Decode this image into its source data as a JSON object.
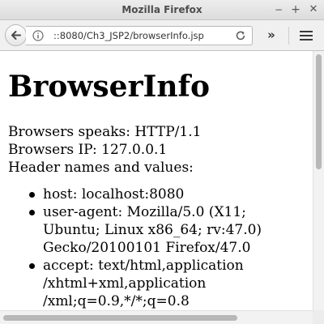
{
  "window": {
    "title": "Mozilla Firefox",
    "controls": {
      "minimize": "−",
      "maximize": "+",
      "close": "✕"
    }
  },
  "toolbar": {
    "back_icon": "back-arrow-icon",
    "info_icon": "info-icon",
    "url": "::8080/Ch3_JSP2/browserInfo.jsp",
    "reload_icon": "reload-icon",
    "overflow_label": "»",
    "menu_icon": "hamburger-menu-icon"
  },
  "page": {
    "heading": "BrowserInfo",
    "lines": [
      "Browsers speaks: HTTP/1.1",
      "Browsers IP: 127.0.0.1",
      "Header names and values:"
    ],
    "headers": [
      "host: localhost:8080",
      "user-agent: Mozilla/5.0 (X11;\nUbuntu; Linux x86_64; rv:47.0)\nGecko/20100101 Firefox/47.0",
      "accept: text/html,application\n/xhtml+xml,application\n/xml;q=0.9,*/*;q=0.8"
    ]
  },
  "scroll": {
    "vertical_fraction": 0.45,
    "horizontal_fraction": 0.75
  },
  "colors": {
    "titlebar": "#e3e3e3",
    "toolbar": "#f0f0f0",
    "content_bg": "#ffffff",
    "text": "#000000",
    "scroll_thumb": "#b8b8b8"
  }
}
